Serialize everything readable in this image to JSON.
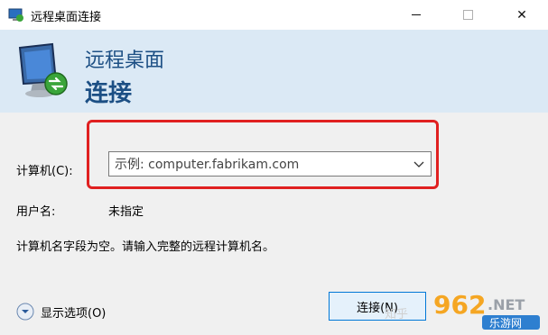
{
  "window": {
    "title": "远程桌面连接",
    "close_glyph": "✕"
  },
  "banner": {
    "line1": "远程桌面",
    "line2": "连接"
  },
  "form": {
    "computer_label": "计算机(C):",
    "computer_placeholder": "示例: computer.fabrikam.com",
    "username_label": "用户名:",
    "username_value": "未指定"
  },
  "message": "计算机名字段为空。请输入完整的远程计算机名。",
  "options": {
    "label": "显示选项(O)"
  },
  "buttons": {
    "connect": "连接(N)"
  },
  "watermark": {
    "text1": "知乎",
    "text2": "962",
    "text3": ".NET",
    "text4": "乐游网"
  },
  "colors": {
    "banner_bg": "#dbe9f5",
    "banner_text": "#1c4f84",
    "highlight": "#e02020",
    "button_border": "#0078d7"
  }
}
